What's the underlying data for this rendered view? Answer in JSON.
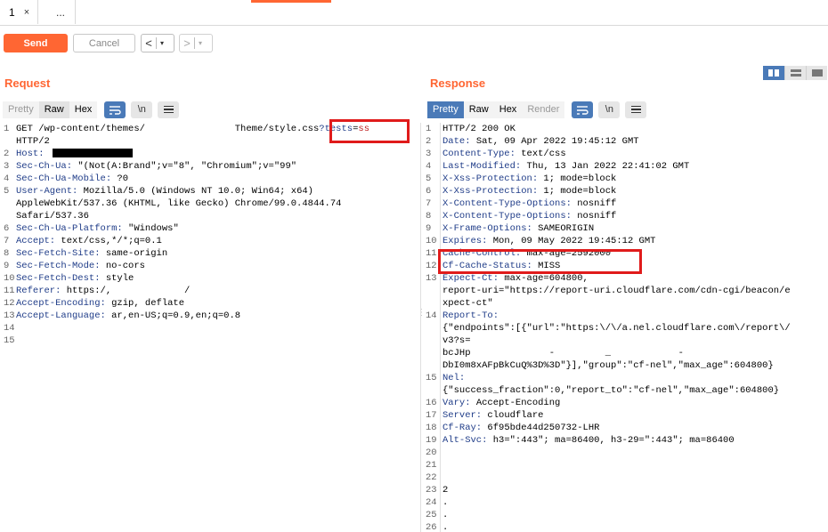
{
  "tabs": {
    "active_number": "1",
    "close_glyph": "×",
    "more_label": "..."
  },
  "toolbar": {
    "send_label": "Send",
    "cancel_label": "Cancel",
    "back_glyph": "<",
    "forward_glyph": ">",
    "dropdown_glyph": "▾"
  },
  "request": {
    "title": "Request",
    "view_tabs": [
      "Pretty",
      "Raw",
      "Hex"
    ],
    "wrap_label": "\\n",
    "lines": [
      {
        "n": "1",
        "parts": [
          [
            "v",
            "GET /wp-content/themes/                Theme/style.css"
          ],
          [
            "qn",
            "?tests"
          ],
          [
            "v",
            "="
          ],
          [
            "qv",
            "ss"
          ]
        ]
      },
      {
        "n": "",
        "parts": [
          [
            "v",
            "HTTP/2"
          ]
        ]
      },
      {
        "n": "2",
        "parts": [
          [
            "k",
            "Host: "
          ]
        ],
        "mask": true
      },
      {
        "n": "3",
        "parts": [
          [
            "k",
            "Sec-Ch-Ua: "
          ],
          [
            "v",
            "\"(Not(A:Brand\";v=\"8\", \"Chromium\";v=\"99\""
          ]
        ]
      },
      {
        "n": "4",
        "parts": [
          [
            "k",
            "Sec-Ch-Ua-Mobile: "
          ],
          [
            "v",
            "?0"
          ]
        ]
      },
      {
        "n": "5",
        "parts": [
          [
            "k",
            "User-Agent: "
          ],
          [
            "v",
            "Mozilla/5.0 (Windows NT 10.0; Win64; x64)"
          ]
        ]
      },
      {
        "n": "",
        "parts": [
          [
            "v",
            "AppleWebKit/537.36 (KHTML, like Gecko) Chrome/99.0.4844.74"
          ]
        ]
      },
      {
        "n": "",
        "parts": [
          [
            "v",
            "Safari/537.36"
          ]
        ]
      },
      {
        "n": "6",
        "parts": [
          [
            "k",
            "Sec-Ch-Ua-Platform: "
          ],
          [
            "v",
            "\"Windows\""
          ]
        ]
      },
      {
        "n": "7",
        "parts": [
          [
            "k",
            "Accept: "
          ],
          [
            "v",
            "text/css,*/*;q=0.1"
          ]
        ]
      },
      {
        "n": "8",
        "parts": [
          [
            "k",
            "Sec-Fetch-Site: "
          ],
          [
            "v",
            "same-origin"
          ]
        ]
      },
      {
        "n": "9",
        "parts": [
          [
            "k",
            "Sec-Fetch-Mode: "
          ],
          [
            "v",
            "no-cors"
          ]
        ]
      },
      {
        "n": "10",
        "parts": [
          [
            "k",
            "Sec-Fetch-Dest: "
          ],
          [
            "v",
            "style"
          ]
        ]
      },
      {
        "n": "11",
        "parts": [
          [
            "k",
            "Referer: "
          ],
          [
            "v",
            "https:/,             /"
          ]
        ]
      },
      {
        "n": "12",
        "parts": [
          [
            "k",
            "Accept-Encoding: "
          ],
          [
            "v",
            "gzip, deflate"
          ]
        ]
      },
      {
        "n": "13",
        "parts": [
          [
            "k",
            "Accept-Language: "
          ],
          [
            "v",
            "ar,en-US;q=0.9,en;q=0.8"
          ]
        ]
      },
      {
        "n": "14",
        "parts": []
      },
      {
        "n": "15",
        "parts": []
      }
    ]
  },
  "response": {
    "title": "Response",
    "view_tabs": [
      "Pretty",
      "Raw",
      "Hex",
      "Render"
    ],
    "wrap_label": "\\n",
    "lines": [
      {
        "n": "1",
        "parts": [
          [
            "v",
            "HTTP/2 200 OK"
          ]
        ]
      },
      {
        "n": "2",
        "parts": [
          [
            "k",
            "Date: "
          ],
          [
            "v",
            "Sat, 09 Apr 2022 19:45:12 GMT"
          ]
        ]
      },
      {
        "n": "3",
        "parts": [
          [
            "k",
            "Content-Type: "
          ],
          [
            "v",
            "text/css"
          ]
        ]
      },
      {
        "n": "4",
        "parts": [
          [
            "k",
            "Last-Modified: "
          ],
          [
            "v",
            "Thu, 13 Jan 2022 22:41:02 GMT"
          ]
        ]
      },
      {
        "n": "5",
        "parts": [
          [
            "k",
            "X-Xss-Protection: "
          ],
          [
            "v",
            "1; mode=block"
          ]
        ]
      },
      {
        "n": "6",
        "parts": [
          [
            "k",
            "X-Xss-Protection: "
          ],
          [
            "v",
            "1; mode=block"
          ]
        ]
      },
      {
        "n": "7",
        "parts": [
          [
            "k",
            "X-Content-Type-Options: "
          ],
          [
            "v",
            "nosniff"
          ]
        ]
      },
      {
        "n": "8",
        "parts": [
          [
            "k",
            "X-Content-Type-Options: "
          ],
          [
            "v",
            "nosniff"
          ]
        ]
      },
      {
        "n": "9",
        "parts": [
          [
            "k",
            "X-Frame-Options: "
          ],
          [
            "v",
            "SAMEORIGIN"
          ]
        ]
      },
      {
        "n": "10",
        "parts": [
          [
            "k",
            "Expires: "
          ],
          [
            "v",
            "Mon, 09 May 2022 19:45:12 GMT"
          ]
        ]
      },
      {
        "n": "11",
        "parts": [
          [
            "k",
            "Cache-Control: "
          ],
          [
            "v",
            "max-age=2592000"
          ]
        ]
      },
      {
        "n": "12",
        "parts": [
          [
            "k",
            "Cf-Cache-Status: "
          ],
          [
            "v",
            "MISS"
          ]
        ]
      },
      {
        "n": "13",
        "parts": [
          [
            "k",
            "Expect-Ct: "
          ],
          [
            "v",
            "max-age=604800,"
          ]
        ]
      },
      {
        "n": "",
        "parts": [
          [
            "v",
            "report-uri=\"https://report-uri.cloudflare.com/cdn-cgi/beacon/e"
          ]
        ]
      },
      {
        "n": "",
        "parts": [
          [
            "v",
            "xpect-ct\""
          ]
        ]
      },
      {
        "n": "14",
        "parts": [
          [
            "k",
            "Report-To:"
          ]
        ]
      },
      {
        "n": "",
        "parts": [
          [
            "v",
            "{\"endpoints\":[{\"url\":\"https:\\/\\/a.nel.cloudflare.com\\/report\\/"
          ]
        ]
      },
      {
        "n": "",
        "parts": [
          [
            "v",
            "v3?s="
          ]
        ]
      },
      {
        "n": "",
        "parts": [
          [
            "v",
            "bcJHp              -         _            -"
          ]
        ]
      },
      {
        "n": "",
        "parts": [
          [
            "v",
            "DbI0m8xAFpBkCuQ%3D%3D\"}],\"group\":\"cf-nel\",\"max_age\":604800}"
          ]
        ]
      },
      {
        "n": "15",
        "parts": [
          [
            "k",
            "Nel:"
          ]
        ]
      },
      {
        "n": "",
        "parts": [
          [
            "v",
            "{\"success_fraction\":0,\"report_to\":\"cf-nel\",\"max_age\":604800}"
          ]
        ]
      },
      {
        "n": "16",
        "parts": [
          [
            "k",
            "Vary: "
          ],
          [
            "v",
            "Accept-Encoding"
          ]
        ]
      },
      {
        "n": "17",
        "parts": [
          [
            "k",
            "Server: "
          ],
          [
            "v",
            "cloudflare"
          ]
        ]
      },
      {
        "n": "18",
        "parts": [
          [
            "k",
            "Cf-Ray: "
          ],
          [
            "v",
            "6f95bde44d250732-LHR"
          ]
        ]
      },
      {
        "n": "19",
        "parts": [
          [
            "k",
            "Alt-Svc: "
          ],
          [
            "v",
            "h3=\":443\"; ma=86400, h3-29=\":443\"; ma=86400"
          ]
        ]
      },
      {
        "n": "20",
        "parts": []
      },
      {
        "n": "21",
        "parts": []
      },
      {
        "n": "22",
        "parts": []
      },
      {
        "n": "23",
        "parts": [
          [
            "v",
            "2"
          ]
        ]
      },
      {
        "n": "24",
        "parts": [
          [
            "v",
            "."
          ]
        ]
      },
      {
        "n": "25",
        "parts": [
          [
            "v",
            "."
          ]
        ]
      },
      {
        "n": "26",
        "parts": [
          [
            "v",
            "."
          ]
        ]
      }
    ]
  },
  "colors": {
    "accent": "#ff6633",
    "blue": "#4a7ab8",
    "highlight": "#e01b1b",
    "header_key": "#1f3c88"
  }
}
